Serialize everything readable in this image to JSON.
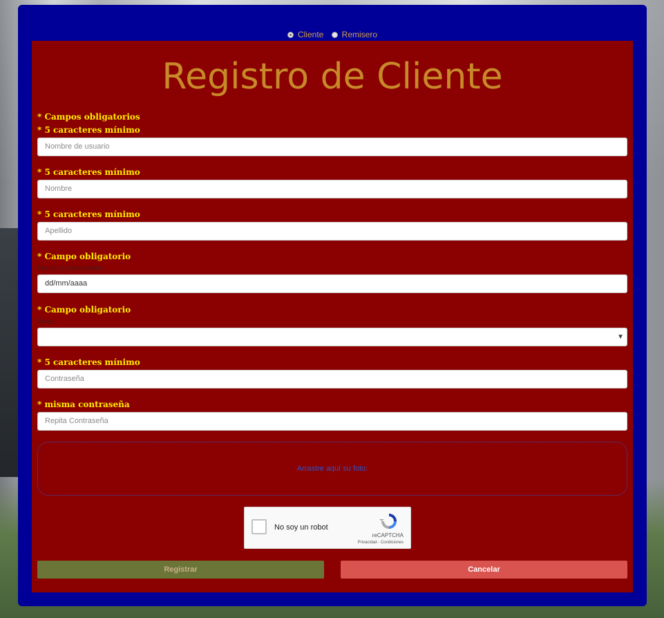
{
  "role_switch": {
    "options": [
      {
        "label": "Cliente",
        "selected": true
      },
      {
        "label": "Remisero",
        "selected": false
      }
    ]
  },
  "form": {
    "title": "Registro de Cliente",
    "required_note": "* Campos obligatorios",
    "fields": [
      {
        "hint": "* 5 caracteres mínimo",
        "placeholder": "Nombre de usuario"
      },
      {
        "hint": "* 5 caracteres mínimo",
        "placeholder": "Nombre"
      },
      {
        "hint": "* 5 caracteres mínimo",
        "placeholder": "Apellido"
      },
      {
        "hint": "* Campo obligatorio",
        "label": "Fecha de nacimiento:",
        "value": "dd/mm/aaaa"
      },
      {
        "hint": "* Campo obligatorio",
        "label": "Sexo:",
        "value": ""
      },
      {
        "hint": "* 5 caracteres mínimo",
        "placeholder": "Contraseña"
      },
      {
        "hint": "* misma contraseña",
        "placeholder": "Repita Contraseña"
      }
    ],
    "photo_drop": "Arrastre aquí su foto:",
    "captcha": {
      "label": "No soy un robot",
      "brand": "reCAPTCHA",
      "links": "Privacidad - Condiciones"
    },
    "buttons": {
      "register": "Registrar",
      "cancel": "Cancelar"
    }
  },
  "colors": {
    "panel": "#000099",
    "form_bg": "#8b0000",
    "title": "#c8892a",
    "hint": "#ffee00",
    "register_button": "#6b7538",
    "cancel_button": "#d9534f"
  }
}
